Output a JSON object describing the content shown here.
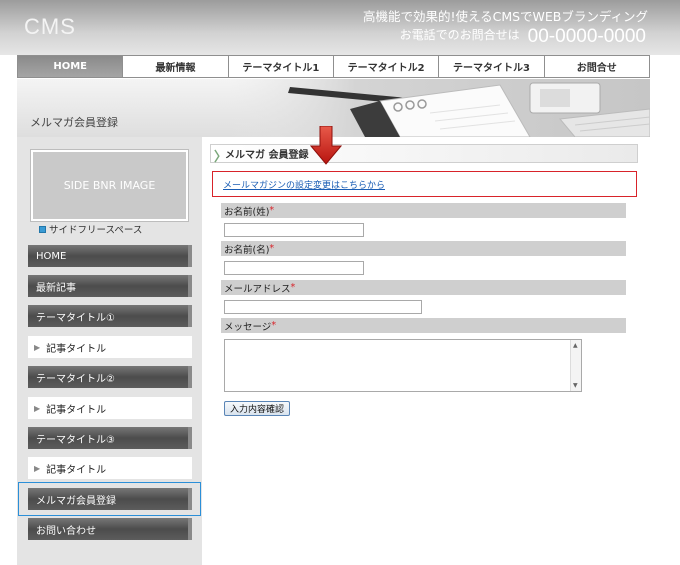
{
  "header": {
    "logo": "CMS",
    "tagline": "高機能で効果的!使えるCMSでWEBブランディング",
    "phone_label": "お電話でのお問合せは",
    "phone_number": "00-0000-0000"
  },
  "nav": {
    "items": [
      "HOME",
      "最新情報",
      "テーマタイトル1",
      "テーマタイトル2",
      "テーマタイトル3",
      "お問合せ"
    ]
  },
  "banner": {
    "title": "メルマガ会員登録"
  },
  "sidebar": {
    "banner_text": "SIDE BNR IMAGE",
    "free_space": "サイドフリースペース",
    "menu": {
      "home": "HOME",
      "latest": "最新記事",
      "theme1": "テーマタイトル①",
      "theme1_article": "記事タイトル",
      "theme2": "テーマタイトル②",
      "theme2_article": "記事タイトル",
      "theme3": "テーマタイトル③",
      "theme3_article": "記事タイトル",
      "newsletter": "メルマガ会員登録",
      "contact": "お問い合わせ"
    }
  },
  "content": {
    "heading": "メルマガ 会員登録",
    "settings_link": "メールマガジンの設定変更はこちらから",
    "fields": {
      "last_name": "お名前(姓)",
      "first_name": "お名前(名)",
      "email": "メールアドレス",
      "message": "メッセージ"
    },
    "required_mark": "*",
    "submit_label": "入力内容確認"
  },
  "colors": {
    "accent_red": "#d8232a",
    "link_blue": "#1a5db4",
    "selection_blue": "#2b8fd8"
  }
}
